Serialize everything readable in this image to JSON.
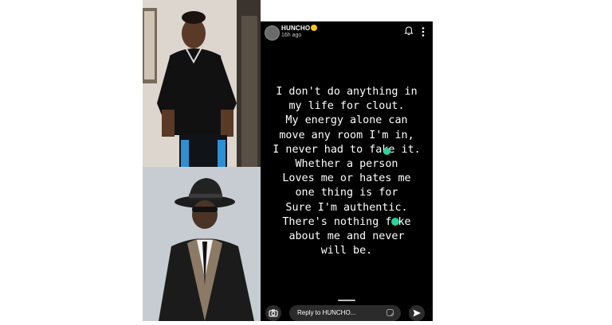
{
  "story": {
    "username": "HUNCHO",
    "time_ago": "16h ago",
    "lines": [
      "I don't do anything in",
      "my life for clout.",
      "My energy alone can",
      "move any room I'm in,",
      "I never had to fake it.",
      "Whether a person",
      "Loves me or hates me",
      "one thing is for",
      "Sure I'm authentic.",
      "There's nothing fake",
      "about me and never",
      "will be."
    ],
    "reply_placeholder": "Reply to HUNCHO..."
  },
  "icons": {
    "verified": "verified-badge-icon",
    "bell": "bell-icon",
    "more": "more-vertical-icon",
    "camera": "camera-icon",
    "sticker": "sticker-icon",
    "send": "send-icon"
  },
  "colors": {
    "story_background": "#000000",
    "verified_badge": "#f5c518",
    "text_highlight": "#2fd09a"
  }
}
